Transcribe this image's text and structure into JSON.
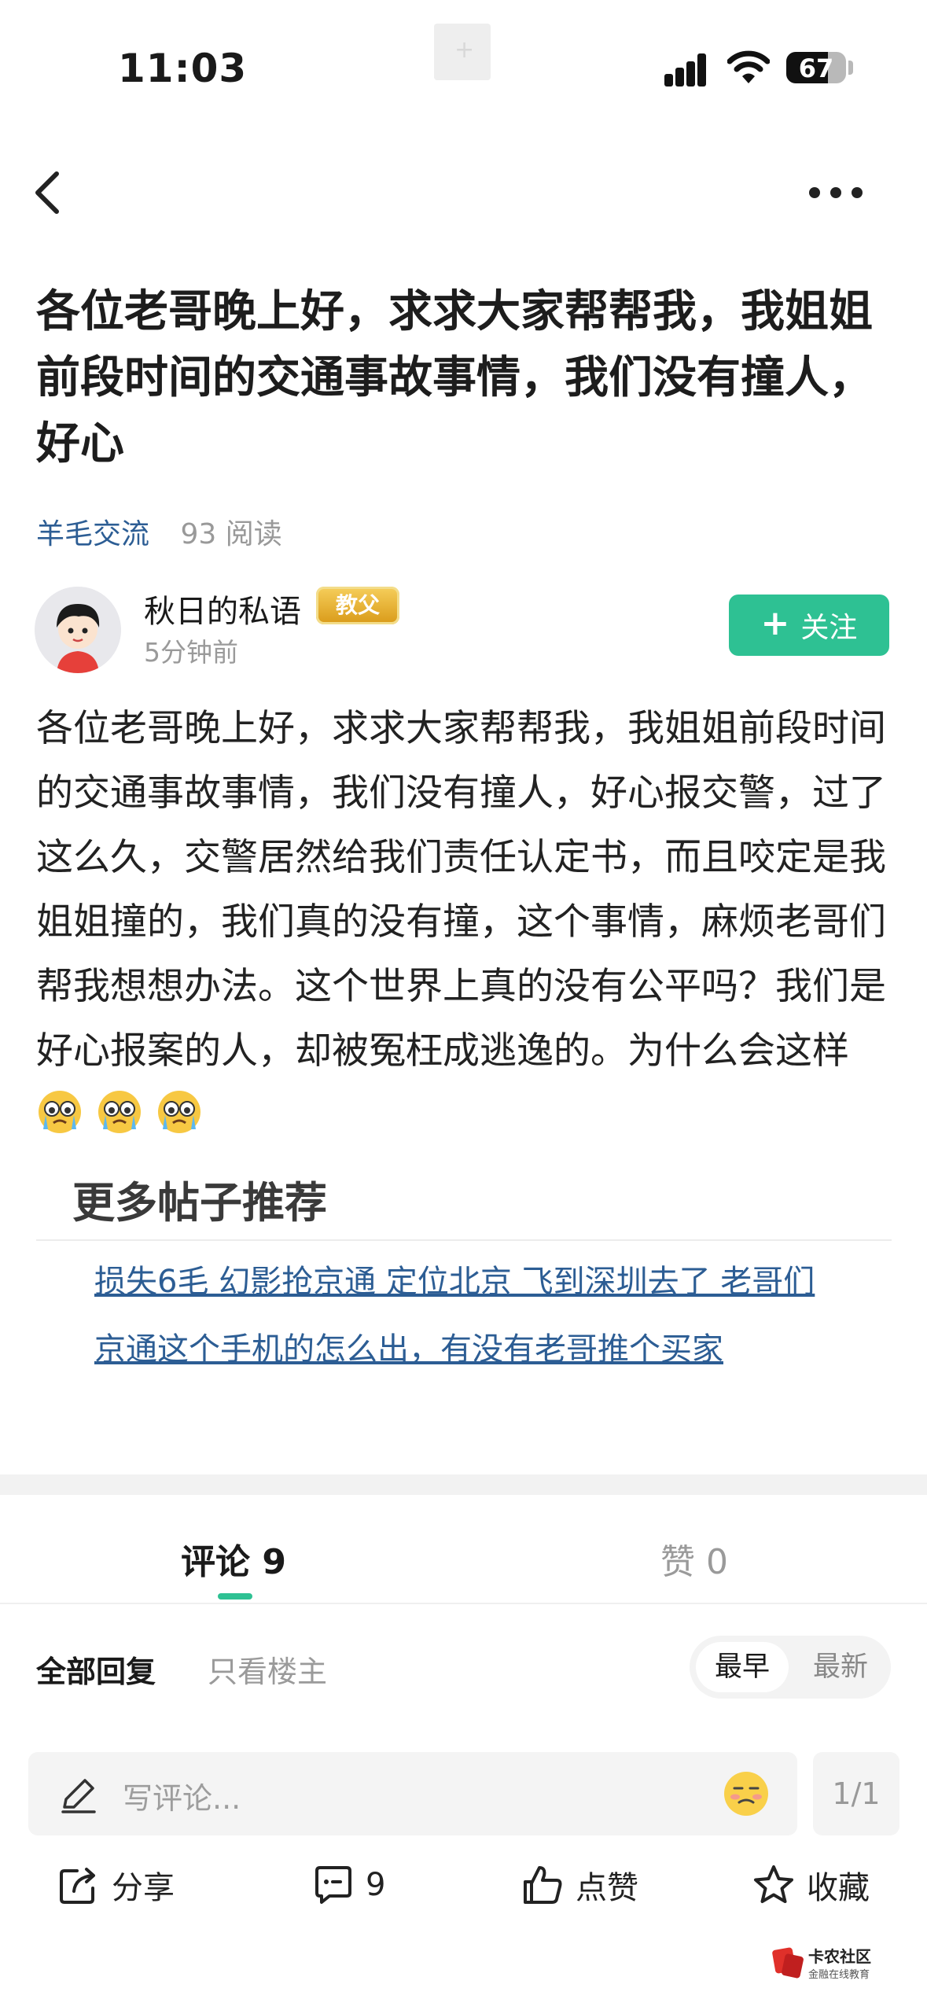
{
  "status_bar": {
    "time": "11:03",
    "battery": "67"
  },
  "post": {
    "title": "各位老哥晚上好，求求大家帮帮我，我姐姐前段时间的交通事故事情，我们没有撞人，好心",
    "category": "羊毛交流",
    "views": "93 阅读",
    "author": "秋日的私语",
    "author_badge": "教父",
    "time": "5分钟前",
    "follow_label": "关注",
    "body": "各位老哥晚上好，求求大家帮帮我，我姐姐前段时间的交通事故事情，我们没有撞人，好心报交警，过了这么久，交警居然给我们责任认定书，而且咬定是我姐姐撞的，我们真的没有撞，这个事情，麻烦老哥们帮我想想办法。这个世界上真的没有公平吗？我们是好心报案的人，却被冤枉成逃逸的。为什么会这样"
  },
  "recommendations": {
    "heading": "更多帖子推荐",
    "links": [
      "损失6毛 幻影抢京通 定位北京 飞到深圳去了 老哥们",
      "京通这个手机的怎么出，有没有老哥推个买家"
    ]
  },
  "tabs": {
    "comments": "评论 9",
    "likes": "赞 0"
  },
  "filters": {
    "all": "全部回复",
    "op_only": "只看楼主",
    "earliest": "最早",
    "latest": "最新"
  },
  "comment_box": {
    "placeholder": "写评论...",
    "page": "1/1"
  },
  "actions": {
    "share": "分享",
    "comments": "9",
    "like": "点赞",
    "favorite": "收藏"
  },
  "watermark": {
    "name": "卡农社区",
    "tagline": "金融在线教育"
  },
  "colors": {
    "accent": "#2ec193",
    "link": "#2c5d94",
    "badge": "#e0a42a"
  }
}
